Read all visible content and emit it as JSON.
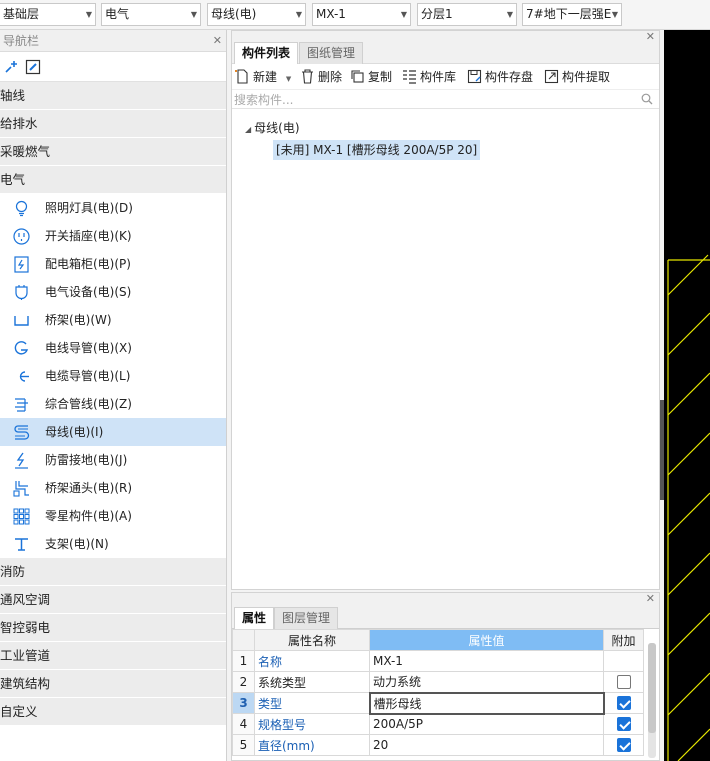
{
  "toolbar": {
    "floor": "基础层",
    "discipline": "电气",
    "category": "母线(电)",
    "component": "MX-1",
    "layer": "分层1",
    "drawing": "7#地下一层强E"
  },
  "nav": {
    "title": "导航栏",
    "categories_top": [
      "轴线",
      "给排水",
      "采暖燃气",
      "电气"
    ],
    "items": [
      {
        "label": "照明灯具(电)(D)",
        "icon": "bulb-icon"
      },
      {
        "label": "开关插座(电)(K)",
        "icon": "socket-icon"
      },
      {
        "label": "配电箱柜(电)(P)",
        "icon": "panel-box-icon"
      },
      {
        "label": "电气设备(电)(S)",
        "icon": "device-icon"
      },
      {
        "label": "桥架(电)(W)",
        "icon": "tray-icon"
      },
      {
        "label": "电线导管(电)(X)",
        "icon": "conduit-icon"
      },
      {
        "label": "电缆导管(电)(L)",
        "icon": "cable-conduit-icon"
      },
      {
        "label": "综合管线(电)(Z)",
        "icon": "pipeline-icon"
      },
      {
        "label": "母线(电)(I)",
        "icon": "busbar-icon",
        "selected": true
      },
      {
        "label": "防雷接地(电)(J)",
        "icon": "lightning-icon"
      },
      {
        "label": "桥架通头(电)(R)",
        "icon": "tray-fitting-icon"
      },
      {
        "label": "零星构件(电)(A)",
        "icon": "grid-icon"
      },
      {
        "label": "支架(电)(N)",
        "icon": "bracket-icon"
      }
    ],
    "categories_bottom": [
      "消防",
      "通风空调",
      "智控弱电",
      "工业管道",
      "建筑结构",
      "自定义"
    ]
  },
  "components": {
    "tabs": [
      "构件列表",
      "图纸管理"
    ],
    "tools": {
      "new": "新建",
      "delete": "删除",
      "copy": "复制",
      "library": "构件库",
      "save": "构件存盘",
      "extract": "构件提取"
    },
    "search_placeholder": "搜索构件...",
    "tree_root": "母线(电)",
    "tree_node": "[未用] MX-1 [槽形母线 200A/5P 20]"
  },
  "properties": {
    "tabs": [
      "属性",
      "图层管理"
    ],
    "headers": {
      "name": "属性名称",
      "value": "属性值",
      "extra": "附加"
    },
    "rows": [
      {
        "num": "1",
        "name": "名称",
        "value": "MX-1",
        "blue": true,
        "check": null
      },
      {
        "num": "2",
        "name": "系统类型",
        "value": "动力系统",
        "blue": false,
        "check": false
      },
      {
        "num": "3",
        "name": "类型",
        "value": "槽形母线",
        "blue": true,
        "check": true,
        "selected": true
      },
      {
        "num": "4",
        "name": "规格型号",
        "value": "200A/5P",
        "blue": true,
        "check": true
      },
      {
        "num": "5",
        "name": "直径(mm)",
        "value": "20",
        "blue": true,
        "check": true
      }
    ]
  },
  "colors": {
    "selection": "#cfe3f7",
    "header_blue": "#7fbcf4",
    "canvas_line": "#e6e600"
  }
}
